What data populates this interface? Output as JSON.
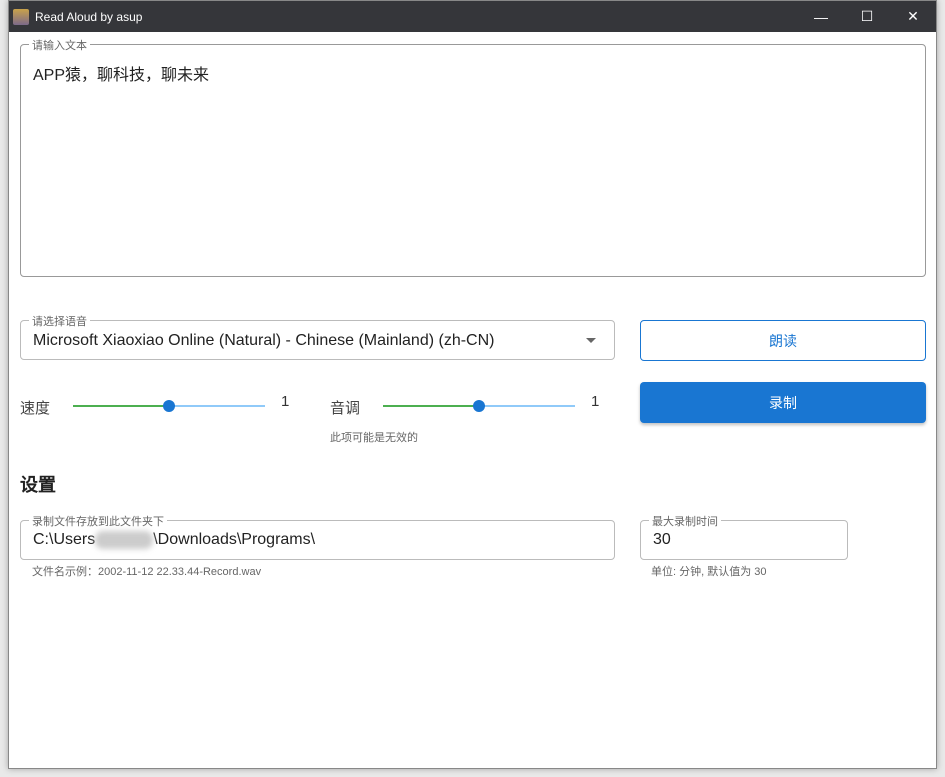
{
  "window": {
    "title": "Read Aloud by asup",
    "minimize": "—",
    "maximize": "☐",
    "close": "✕"
  },
  "text_input": {
    "label": "请输入文本",
    "value": "APP猿，聊科技，聊未来"
  },
  "voice_select": {
    "label": "请选择语音",
    "value": "Microsoft Xiaoxiao Online (Natural) - Chinese (Mainland) (zh-CN)"
  },
  "speed": {
    "label": "速度",
    "value": "1",
    "fraction": 0.5
  },
  "pitch": {
    "label": "音调",
    "value": "1",
    "fraction": 0.5,
    "hint": "此项可能是无效的"
  },
  "buttons": {
    "read": "朗读",
    "record": "录制"
  },
  "settings": {
    "heading": "设置",
    "folder": {
      "label": "录制文件存放到此文件夹下",
      "value_prefix": "C:\\Users",
      "value_suffix": "\\Downloads\\Programs\\",
      "hint": "文件名示例：2002-11-12 22.33.44-Record.wav"
    },
    "max_time": {
      "label": "最大录制时间",
      "value": "30",
      "hint": "单位: 分钟, 默认值为 30"
    }
  },
  "colors": {
    "primary": "#1976d2",
    "green": "#4caf50"
  }
}
